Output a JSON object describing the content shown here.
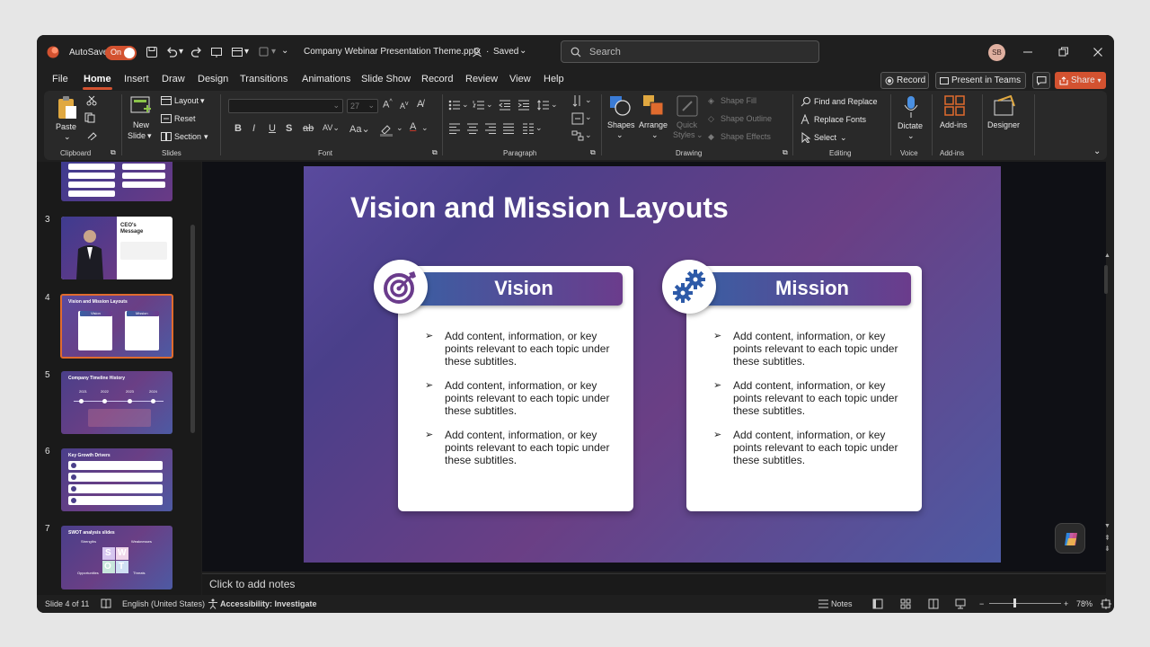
{
  "titlebar": {
    "autosave_label": "AutoSave",
    "autosave_state": "On",
    "file_name": "Company Webinar Presentation Theme.pptx",
    "saved_status": "Saved",
    "search_placeholder": "Search",
    "user_initials": "SB"
  },
  "menu": {
    "items": [
      "File",
      "Home",
      "Insert",
      "Draw",
      "Design",
      "Transitions",
      "Animations",
      "Slide Show",
      "Record",
      "Review",
      "View",
      "Help"
    ],
    "active": "Home",
    "record_button": "Record",
    "present_teams_button": "Present in Teams",
    "share_button": "Share"
  },
  "ribbon": {
    "clipboard": {
      "paste": "Paste",
      "group": "Clipboard"
    },
    "slides": {
      "new_slide_line1": "New",
      "new_slide_line2": "Slide",
      "layout": "Layout",
      "reset": "Reset",
      "section": "Section",
      "group": "Slides"
    },
    "font": {
      "size_value": "27",
      "group": "Font"
    },
    "paragraph": {
      "group": "Paragraph"
    },
    "drawing": {
      "shapes": "Shapes",
      "arrange": "Arrange",
      "quick_styles_line1": "Quick",
      "quick_styles_line2": "Styles",
      "shape_fill": "Shape Fill",
      "shape_outline": "Shape Outline",
      "shape_effects": "Shape Effects",
      "group": "Drawing"
    },
    "editing": {
      "find_replace": "Find and Replace",
      "replace_fonts": "Replace Fonts",
      "select": "Select",
      "group": "Editing"
    },
    "voice": {
      "dictate": "Dictate",
      "group": "Voice"
    },
    "addins": {
      "addins": "Add-ins",
      "group": "Add-ins"
    },
    "designer": {
      "designer": "Designer"
    }
  },
  "thumbnails": {
    "slide3": {
      "number": "3",
      "title_line1": "CEO's",
      "title_line2": "Message"
    },
    "slide4": {
      "number": "4",
      "title": "Vision and Mission Layouts",
      "vision": "Vision",
      "mission": "Mission"
    },
    "slide5": {
      "number": "5",
      "title": "Company Timeline History",
      "years": [
        "2021",
        "2022",
        "2023",
        "2024"
      ]
    },
    "slide6": {
      "number": "6",
      "title": "Key Growth Drivers"
    },
    "slide7": {
      "number": "7",
      "title": "SWOT analysis slides",
      "strengths": "Strengths",
      "weaknesses": "Weaknesses",
      "opportunities": "Opportunities",
      "threats": "Threats",
      "letters": [
        "S",
        "W",
        "O",
        "T"
      ]
    }
  },
  "slide": {
    "title": "Vision and Mission Layouts",
    "vision": {
      "heading": "Vision",
      "bullets": [
        "Add content, information, or key points relevant to each topic under these subtitles.",
        "Add content, information, or key points relevant to each topic under these subtitles.",
        "Add content, information, or key points relevant to each topic under these subtitles."
      ]
    },
    "mission": {
      "heading": "Mission",
      "bullets": [
        "Add content, information, or key points relevant to each topic under these subtitles.",
        "Add content, information, or key points relevant to each topic under these subtitles.",
        "Add content, information, or key points relevant to each topic under these subtitles."
      ]
    }
  },
  "notes_placeholder": "Click to add notes",
  "status": {
    "slide_count": "Slide 4 of 11",
    "language": "English (United States)",
    "accessibility": "Accessibility: Investigate",
    "notes": "Notes",
    "zoom": "78%"
  },
  "colors": {
    "accent": "#d35230",
    "slide_gradient_start": "#5a4a9e",
    "slide_gradient_end": "#4d5aa3",
    "banner_start": "#3a5fa3",
    "banner_end": "#6b3c8c"
  }
}
